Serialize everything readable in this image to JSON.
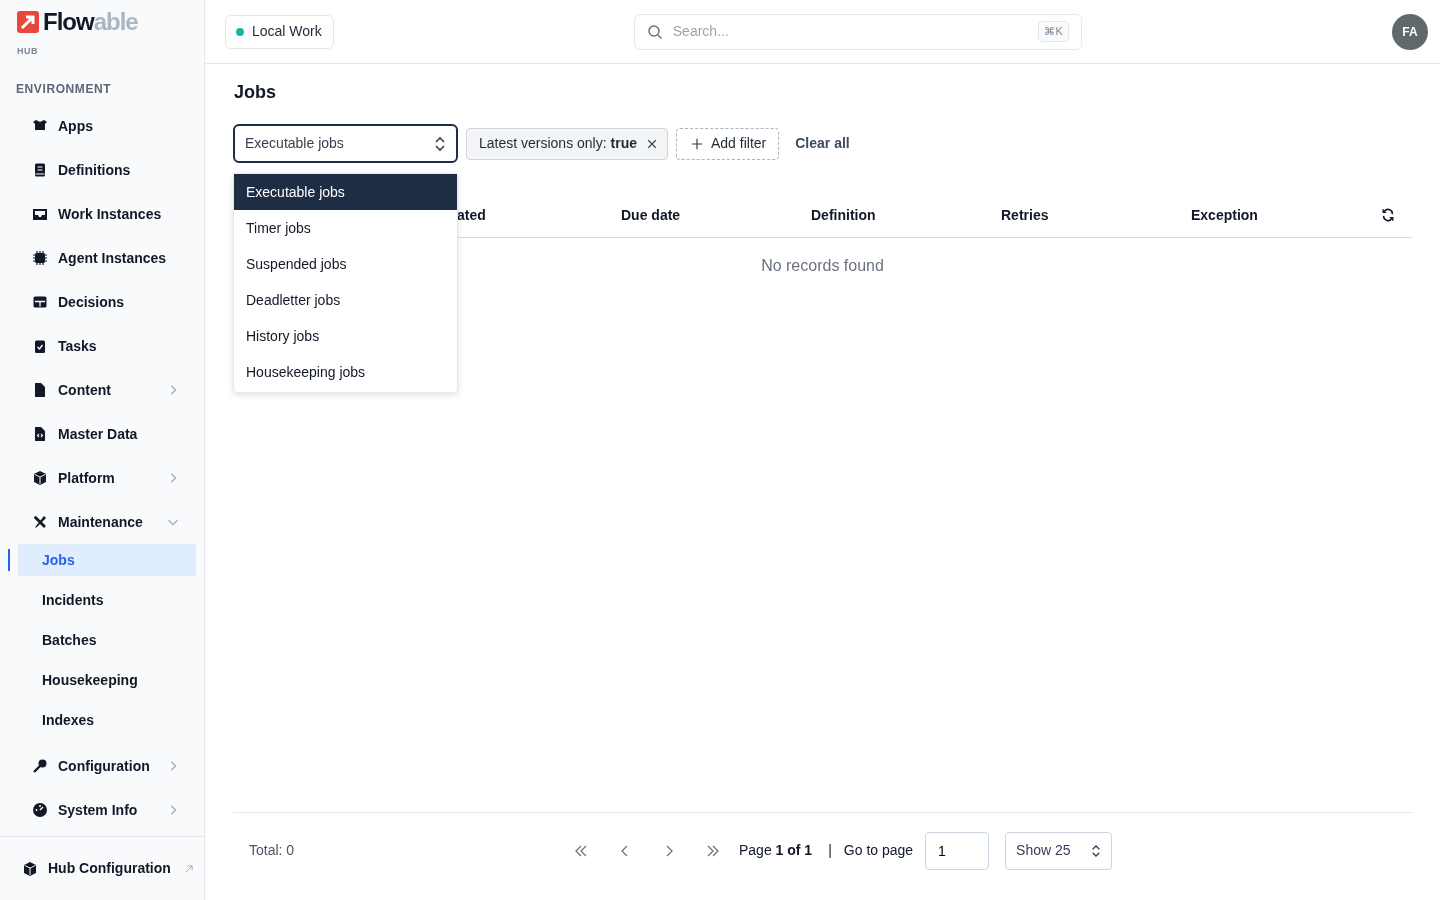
{
  "brand": {
    "logo_dark": "Flow",
    "logo_light": "able",
    "subtitle": "HUB"
  },
  "sidebar": {
    "section": "ENVIRONMENT",
    "items": [
      {
        "label": "Apps",
        "kind": "link",
        "selected": false
      },
      {
        "label": "Definitions",
        "kind": "link",
        "selected": false
      },
      {
        "label": "Work Instances",
        "kind": "link",
        "selected": false
      },
      {
        "label": "Agent Instances",
        "kind": "link",
        "selected": false
      },
      {
        "label": "Decisions",
        "kind": "link",
        "selected": false
      },
      {
        "label": "Tasks",
        "kind": "link",
        "selected": false
      },
      {
        "label": "Content",
        "kind": "group",
        "expanded": false,
        "selected": false
      },
      {
        "label": "Master Data",
        "kind": "link",
        "selected": false
      },
      {
        "label": "Platform",
        "kind": "group",
        "expanded": false,
        "selected": false
      },
      {
        "label": "Maintenance",
        "kind": "group",
        "expanded": true,
        "selected": false,
        "children": [
          {
            "label": "Jobs",
            "selected": true
          },
          {
            "label": "Incidents",
            "selected": false
          },
          {
            "label": "Batches",
            "selected": false
          },
          {
            "label": "Housekeeping",
            "selected": false
          },
          {
            "label": "Indexes",
            "selected": false
          }
        ]
      },
      {
        "label": "Configuration",
        "kind": "group",
        "expanded": false,
        "selected": false
      },
      {
        "label": "System Info",
        "kind": "group",
        "expanded": false,
        "selected": false
      }
    ],
    "footer": {
      "label": "Hub Configuration"
    }
  },
  "topbar": {
    "environment": {
      "label": "Local Work",
      "color": "#14b8a6"
    },
    "search": {
      "placeholder": "Search...",
      "shortcut": "⌘K"
    },
    "avatar": "FA"
  },
  "page": {
    "title": "Jobs"
  },
  "filters": {
    "job_type": {
      "value": "Executable jobs",
      "expanded": true,
      "options": [
        {
          "label": "Executable jobs",
          "selected": true
        },
        {
          "label": "Timer jobs",
          "selected": false
        },
        {
          "label": "Suspended jobs",
          "selected": false
        },
        {
          "label": "Deadletter jobs",
          "selected": false
        },
        {
          "label": "History jobs",
          "selected": false
        },
        {
          "label": "Housekeeping jobs",
          "selected": false
        }
      ]
    },
    "chips": [
      {
        "label": "Latest versions only: **true**"
      }
    ],
    "add_filter": "Add filter",
    "clear_all": "Clear all"
  },
  "table": {
    "columns": [
      "ated",
      "Due date",
      "Definition",
      "Retries",
      "Exception"
    ],
    "empty_message": "No records found"
  },
  "pagination": {
    "total": "Total: 0",
    "page_info": "Page **1 of 1**",
    "separator": "|",
    "go_to_label": "Go to page",
    "page_value": "1",
    "page_size": "Show 25"
  }
}
